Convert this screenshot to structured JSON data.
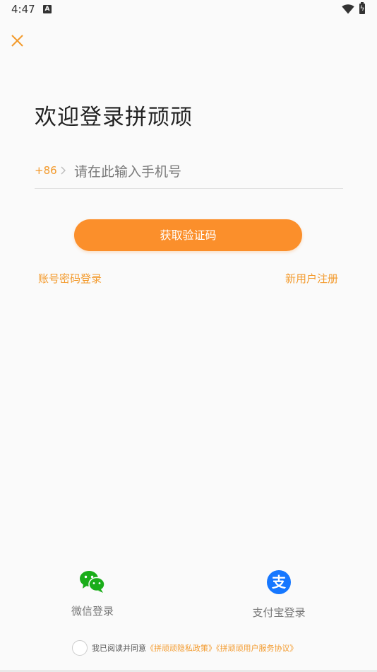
{
  "status": {
    "time": "4:47",
    "notification": "A"
  },
  "header": {
    "title": "欢迎登录拼顽顽"
  },
  "phone": {
    "country_code": "+86",
    "placeholder": "请在此输入手机号"
  },
  "actions": {
    "get_code": "获取验证码",
    "password_login": "账号密码登录",
    "register": "新用户注册"
  },
  "social": {
    "wechat": "微信登录",
    "alipay": "支付宝登录"
  },
  "agreement": {
    "prefix": "我已阅读并同意",
    "privacy": "《拼顽顽隐私政策》",
    "terms": "《拼顽顽用户服务协议》"
  },
  "colors": {
    "accent": "#fb8f2b",
    "wechat": "#1aad19",
    "alipay": "#1677ff"
  },
  "icons": [
    "close-icon",
    "chevron-right-icon",
    "wechat-icon",
    "alipay-icon",
    "wifi-icon",
    "battery-icon"
  ]
}
